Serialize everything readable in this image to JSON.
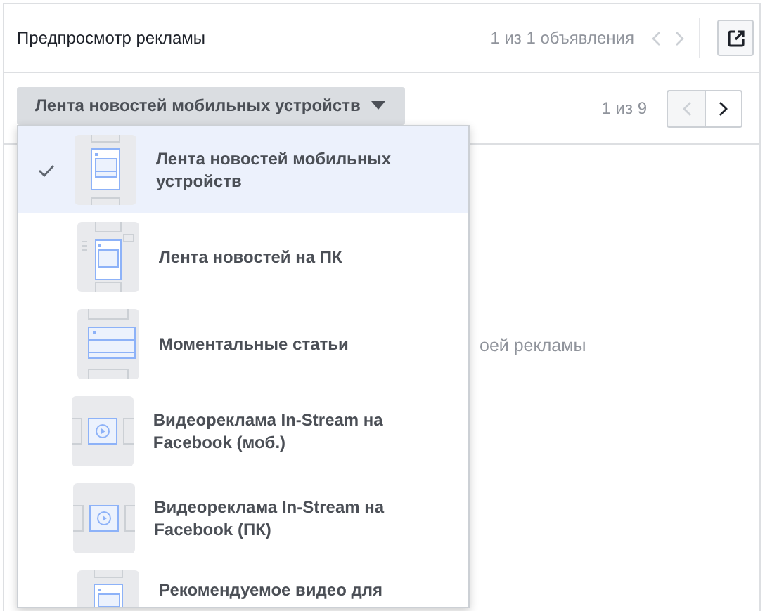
{
  "header": {
    "title": "Предпросмотр рекламы",
    "counter": "1 из 1 объявления"
  },
  "placement": {
    "label": "Лента новостей мобильных устройств",
    "counter": "1 из 9"
  },
  "preview": {
    "message": "оей рекламы"
  },
  "menu": [
    {
      "label": "Лента новостей мобильных устройств",
      "kind": "mobile",
      "selected": true
    },
    {
      "label": "Лента новостей на ПК",
      "kind": "desktop",
      "selected": false
    },
    {
      "label": "Моментальные статьи",
      "kind": "article",
      "selected": false
    },
    {
      "label": "Видеореклама In-Stream на Facebook (моб.)",
      "kind": "video",
      "selected": false
    },
    {
      "label": "Видеореклама In-Stream на Facebook (ПК)",
      "kind": "video",
      "selected": false
    },
    {
      "label": "Рекомендуемое видео для",
      "kind": "mobile",
      "selected": false
    }
  ]
}
